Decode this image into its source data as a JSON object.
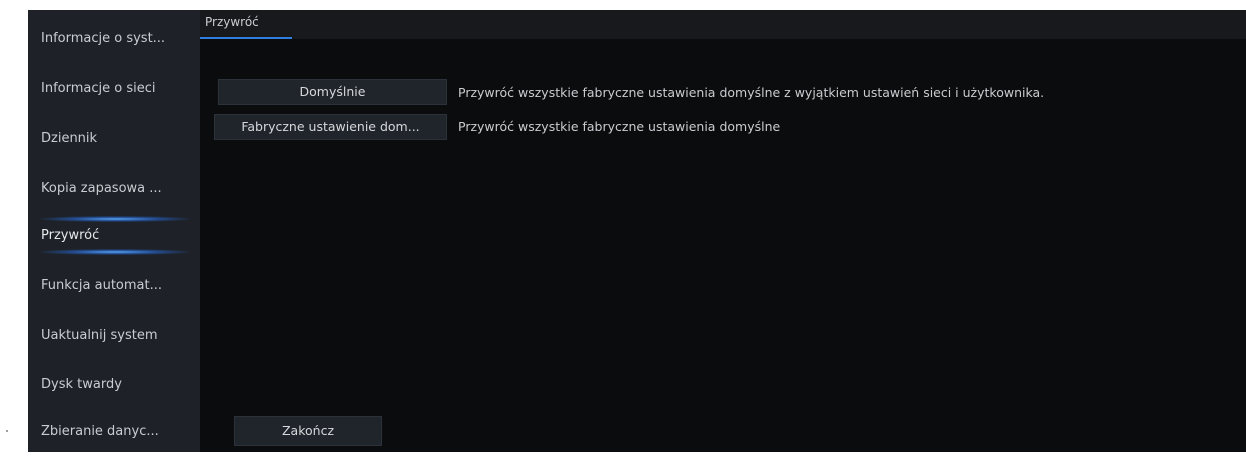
{
  "sidebar": {
    "items": [
      {
        "label": "Informacje o syst..."
      },
      {
        "label": "Informacje o sieci"
      },
      {
        "label": "Dziennik"
      },
      {
        "label": "Kopia zapasowa ..."
      },
      {
        "label": "Przywróć",
        "active": true
      },
      {
        "label": "Funkcja automat..."
      },
      {
        "label": "Uaktualnij system"
      },
      {
        "label": "Dysk twardy"
      },
      {
        "label": "Zbieranie danyc..."
      }
    ]
  },
  "main": {
    "tab": {
      "label": "Przywróć"
    },
    "actions": [
      {
        "button_label": "Domyślnie",
        "description": "Przywróć wszystkie fabryczne ustawienia domyślne z wyjątkiem ustawień sieci i użytkownika."
      },
      {
        "button_label": "Fabryczne ustawienie dom...",
        "description": "Przywróć wszystkie fabryczne ustawienia domyślne"
      }
    ],
    "exit_button": {
      "label": "Zakończ"
    }
  },
  "colors": {
    "sidebar_bg": "#1e2228",
    "content_bg": "#0b0c0e",
    "accent": "#2f7de1",
    "text": "#c9ccd0"
  }
}
